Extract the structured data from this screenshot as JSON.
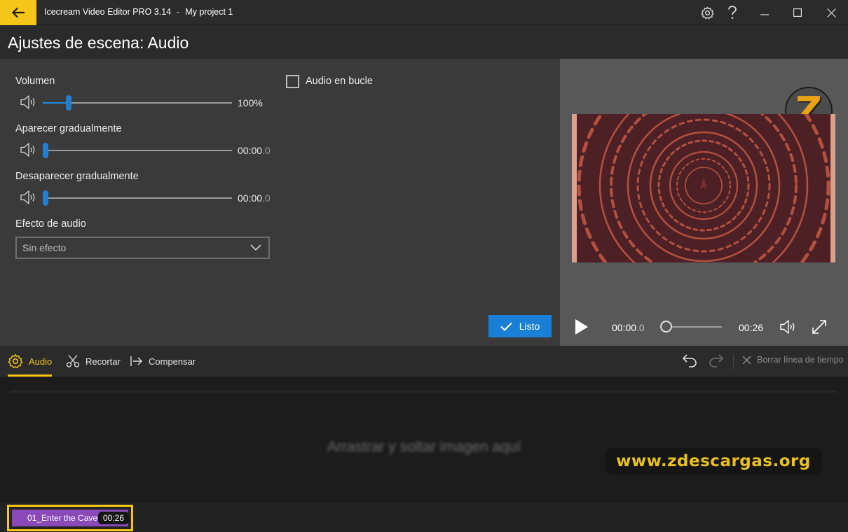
{
  "titlebar": {
    "app_name": "Icecream Video Editor PRO 3.14",
    "separator": "-",
    "project_name": "My project 1",
    "accent_color": "#f5c518"
  },
  "header": {
    "title": "Ajustes de escena: Audio"
  },
  "settings": {
    "volume": {
      "label": "Volumen",
      "value_text": "100%",
      "level_percent": 100
    },
    "fade_in": {
      "label": "Aparecer gradualmente",
      "value_main": "00:00",
      "value_frac": ".0",
      "level_percent": 0
    },
    "fade_out": {
      "label": "Desaparecer gradualmente",
      "value_main": "00:00",
      "value_frac": ".0",
      "level_percent": 0
    },
    "loop": {
      "label": "Audio en bucle",
      "checked": false
    },
    "effect": {
      "label": "Efecto de audio",
      "selected": "Sin efecto"
    },
    "done_label": "Listo",
    "slider_color": "#1e7fd8"
  },
  "preview": {
    "current_main": "00:00",
    "current_frac": ".0",
    "total": "00:26",
    "logo_letter": "Z"
  },
  "toolbar": {
    "tabs": [
      {
        "label": "Audio",
        "icon": "gear-icon",
        "active": true
      },
      {
        "label": "Recortar",
        "icon": "scissors-icon",
        "active": false
      },
      {
        "label": "Compensar",
        "icon": "arrow-to-line-icon",
        "active": false
      }
    ],
    "clear_label": "Borrar línea de tiempo"
  },
  "timeline": {
    "drop_hint": "Arrastrar y soltar imagen aquí",
    "site_banner": "www.zdescargas.org",
    "clip": {
      "name": "01_Enter the Caves",
      "duration": "00:26",
      "color": "#8a49b8"
    }
  }
}
